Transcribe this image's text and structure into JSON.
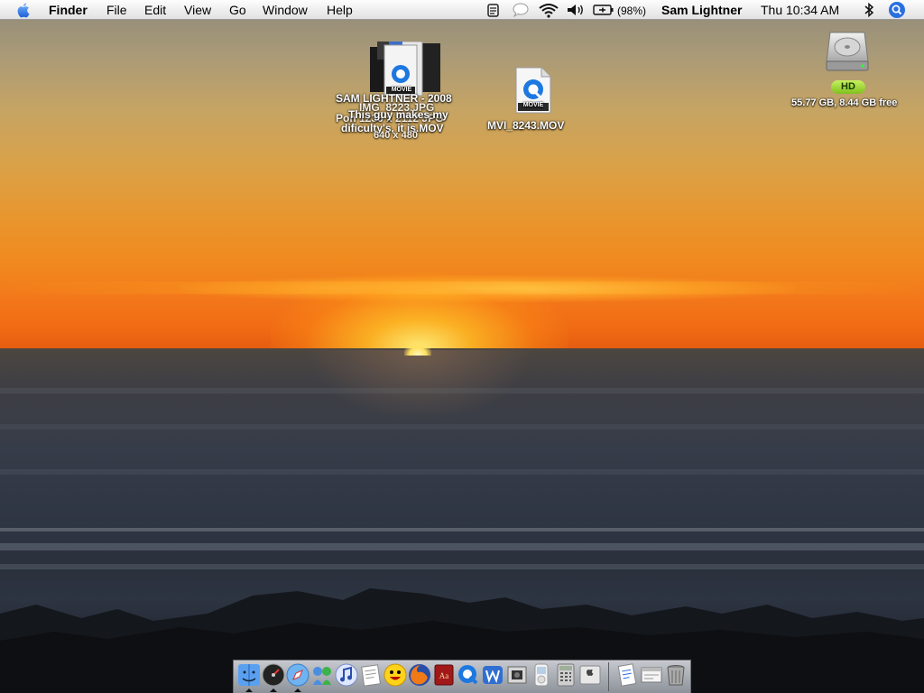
{
  "menubar": {
    "app_name": "Finder",
    "menus": [
      "File",
      "Edit",
      "View",
      "Go",
      "Window",
      "Help"
    ],
    "battery_percent": "(98%)",
    "user_name": "Sam Lightner",
    "clock": "Thu 10:34 AM"
  },
  "desktop": {
    "overlapping_labels": [
      "SAM LIGHTNER - 2008",
      "IMG_8223.JPG",
      "Pon 1236 x 2112 JPG",
      "This guy makes my",
      "dificulty's, it is.MOV",
      "640 x 480"
    ],
    "movie_file": {
      "name": "MVI_8243.MOV",
      "badge": "MOVIE"
    },
    "stack_badge": "MOVIE",
    "hard_drive": {
      "badge": "HD",
      "info": "55.77 GB, 8.44 GB free"
    }
  },
  "dock": {
    "items": [
      {
        "name": "finder-icon"
      },
      {
        "name": "dashboard-icon"
      },
      {
        "name": "safari-icon"
      },
      {
        "name": "ichat-icon"
      },
      {
        "name": "itunes-icon"
      },
      {
        "name": "textedit-icon"
      },
      {
        "name": "adium-icon"
      },
      {
        "name": "firefox-icon"
      },
      {
        "name": "dictionary-icon"
      },
      {
        "name": "quicktime-icon"
      },
      {
        "name": "word-icon"
      },
      {
        "name": "photo-booth-icon"
      },
      {
        "name": "ipod-icon"
      },
      {
        "name": "calculator-icon"
      },
      {
        "name": "system-preferences-icon"
      },
      {
        "name": "document-icon"
      },
      {
        "name": "window-icon"
      },
      {
        "name": "trash-icon"
      }
    ]
  },
  "colors": {
    "accent_search": "#2a6fe0",
    "hd_badge": "#8fd12a"
  }
}
